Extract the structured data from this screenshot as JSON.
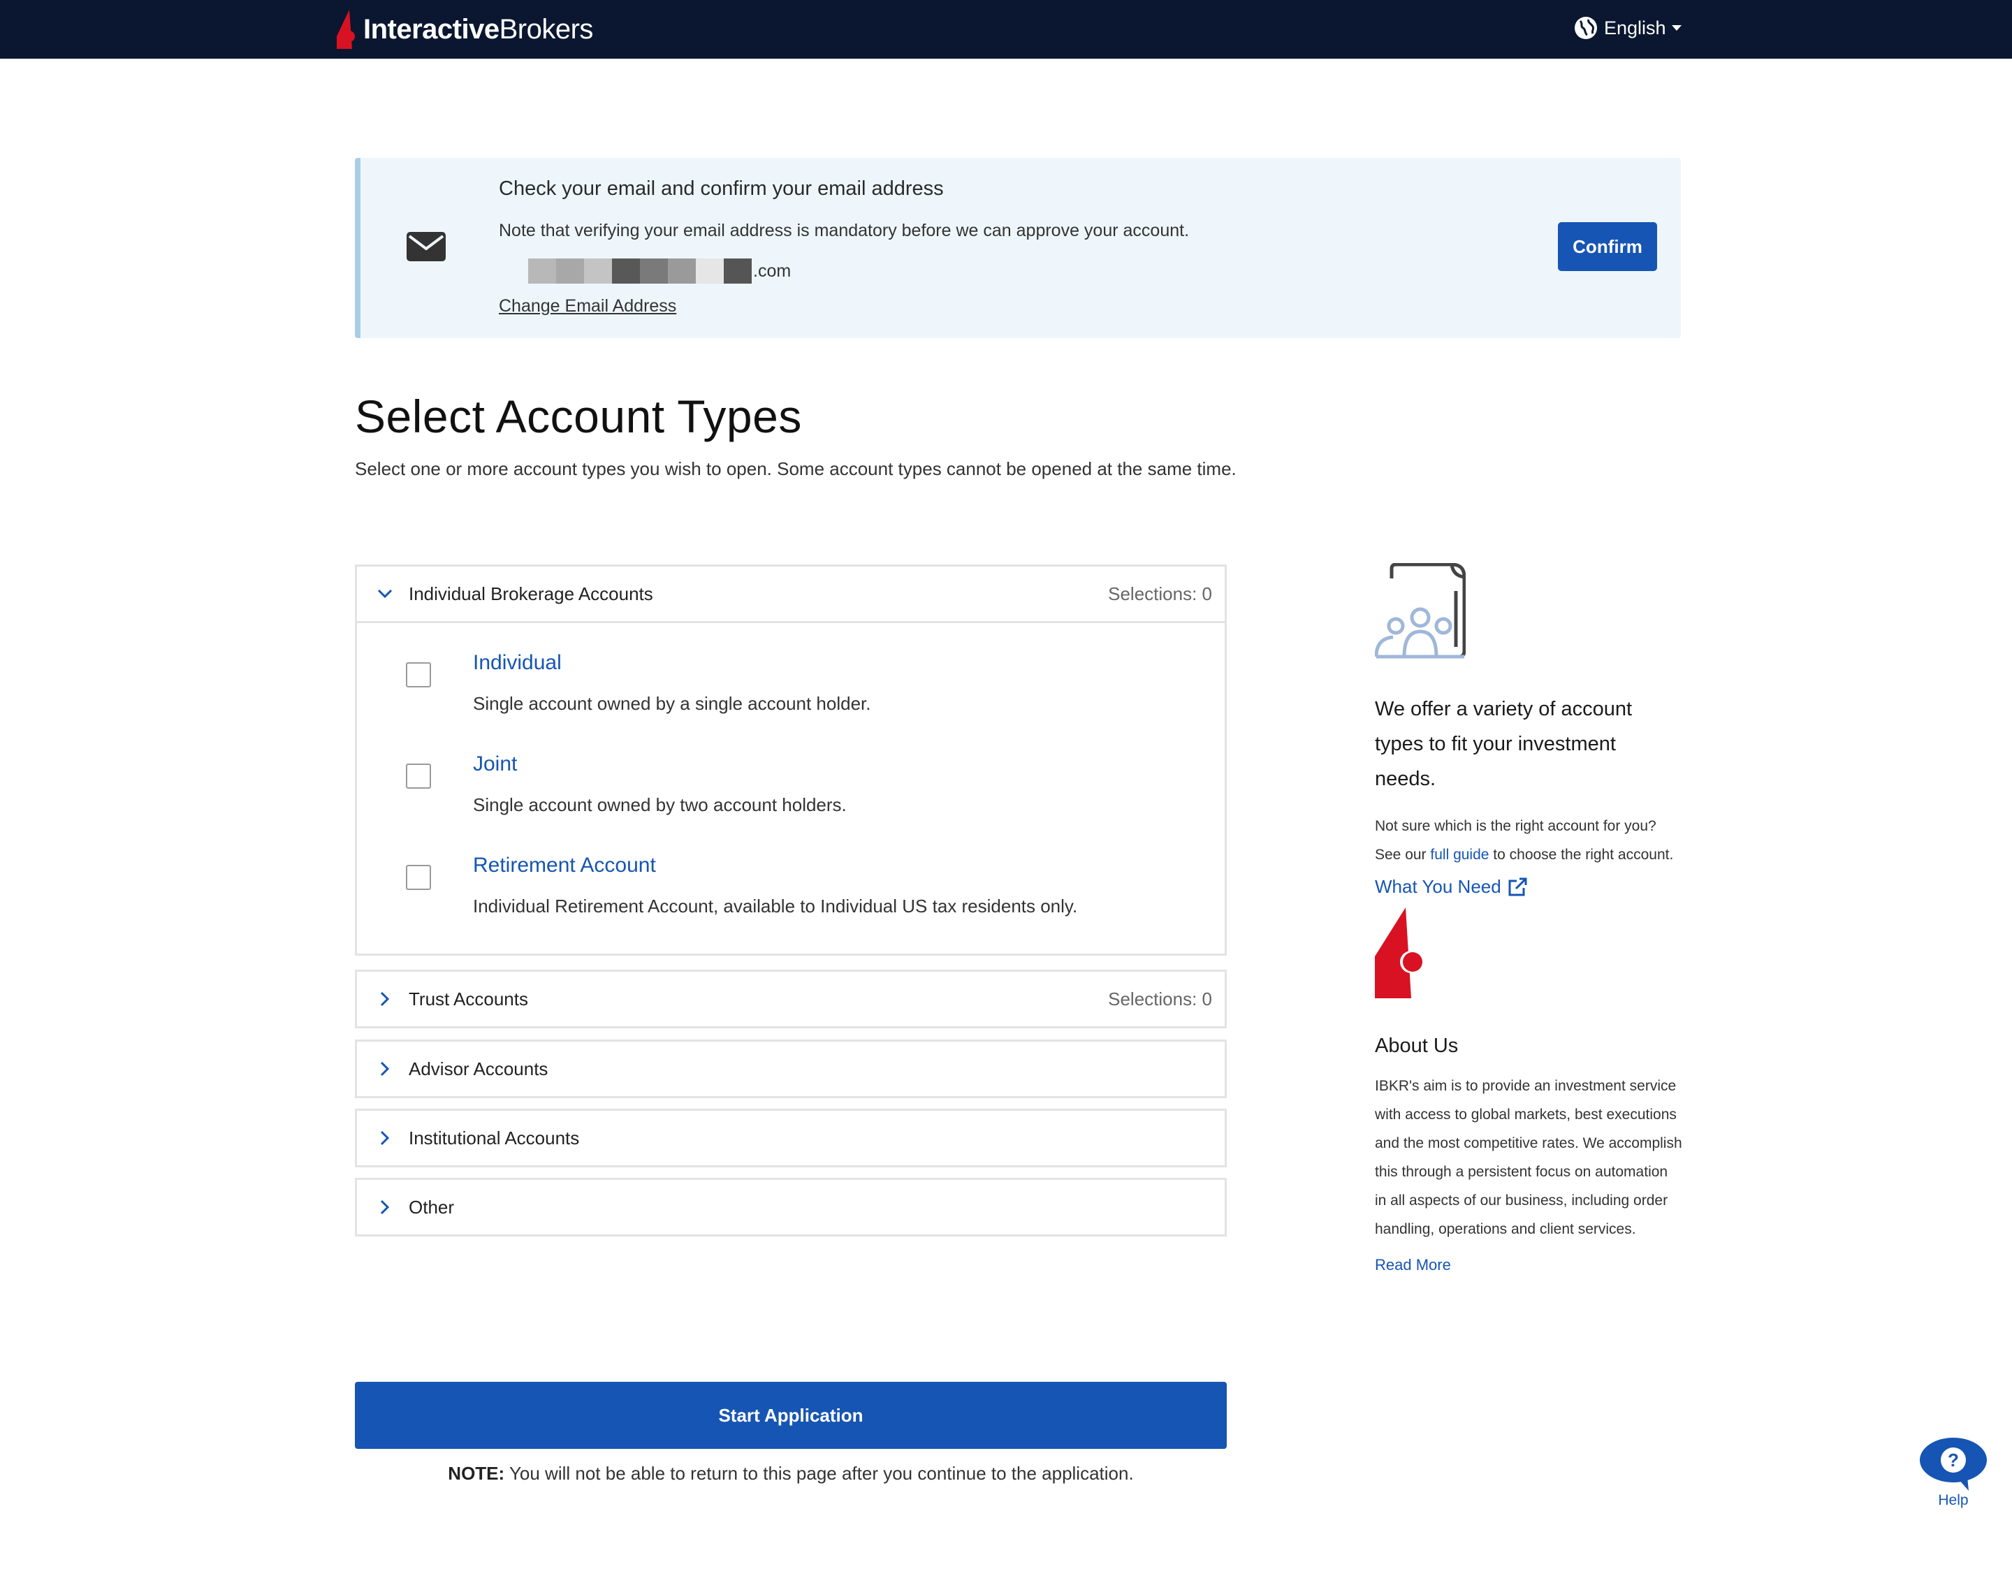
{
  "colors": {
    "nav_bg": "#0b1730",
    "primary": "#1655b3",
    "brand_red": "#d81222",
    "banner_bg": "#eef6fb",
    "banner_accent": "#a9cfe6"
  },
  "header": {
    "logo_bold": "Interactive",
    "logo_light": "Brokers",
    "language": "English",
    "language_icon": "globe-icon"
  },
  "banner": {
    "icon": "envelope-icon",
    "title": "Check your email and confirm your email address",
    "note": "Note that verifying your email address is mandatory before we can approve your account.",
    "email_suffix": ".com",
    "change_link": "Change Email Address",
    "confirm_label": "Confirm"
  },
  "page": {
    "title": "Select Account Types",
    "subtitle": "Select one or more account types you wish to open. Some account types cannot be opened at the same time."
  },
  "accordions": [
    {
      "label": "Individual Brokerage Accounts",
      "selections": "Selections: 0",
      "expanded": true,
      "options": [
        {
          "title": "Individual",
          "desc": "Single account owned by a single account holder.",
          "checked": false
        },
        {
          "title": "Joint",
          "desc": "Single account owned by two account holders.",
          "checked": false
        },
        {
          "title": "Retirement Account",
          "desc": "Individual Retirement Account, available to Individual US tax residents only.",
          "checked": false
        }
      ]
    },
    {
      "label": "Trust Accounts",
      "selections": "Selections: 0",
      "expanded": false
    },
    {
      "label": "Advisor Accounts",
      "selections": "",
      "expanded": false
    },
    {
      "label": "Institutional Accounts",
      "selections": "",
      "expanded": false
    },
    {
      "label": "Other",
      "selections": "",
      "expanded": false
    }
  ],
  "start": {
    "label": "Start Application",
    "note_bold": "NOTE:",
    "note_text": " You will not be able to return to this page after you continue to the application."
  },
  "sidebar": {
    "illustration": "account-holders-document-icon",
    "heading": "We offer a variety of account types to fit your investment needs.",
    "guide_pre": "Not sure which is the right account for you? See our ",
    "guide_link": "full guide",
    "guide_post": " to choose the right account.",
    "what_you_need": "What You Need",
    "external_icon": "external-link-icon",
    "about_title": "About Us",
    "about_text": "IBKR's aim is to provide an investment service with access to global markets, best executions and the most competitive rates. We accomplish this through a persistent focus on automation in all aspects of our business, including order handling, operations and client services.",
    "read_more": "Read More"
  },
  "help": {
    "label": "Help",
    "icon": "question-chat-icon"
  }
}
